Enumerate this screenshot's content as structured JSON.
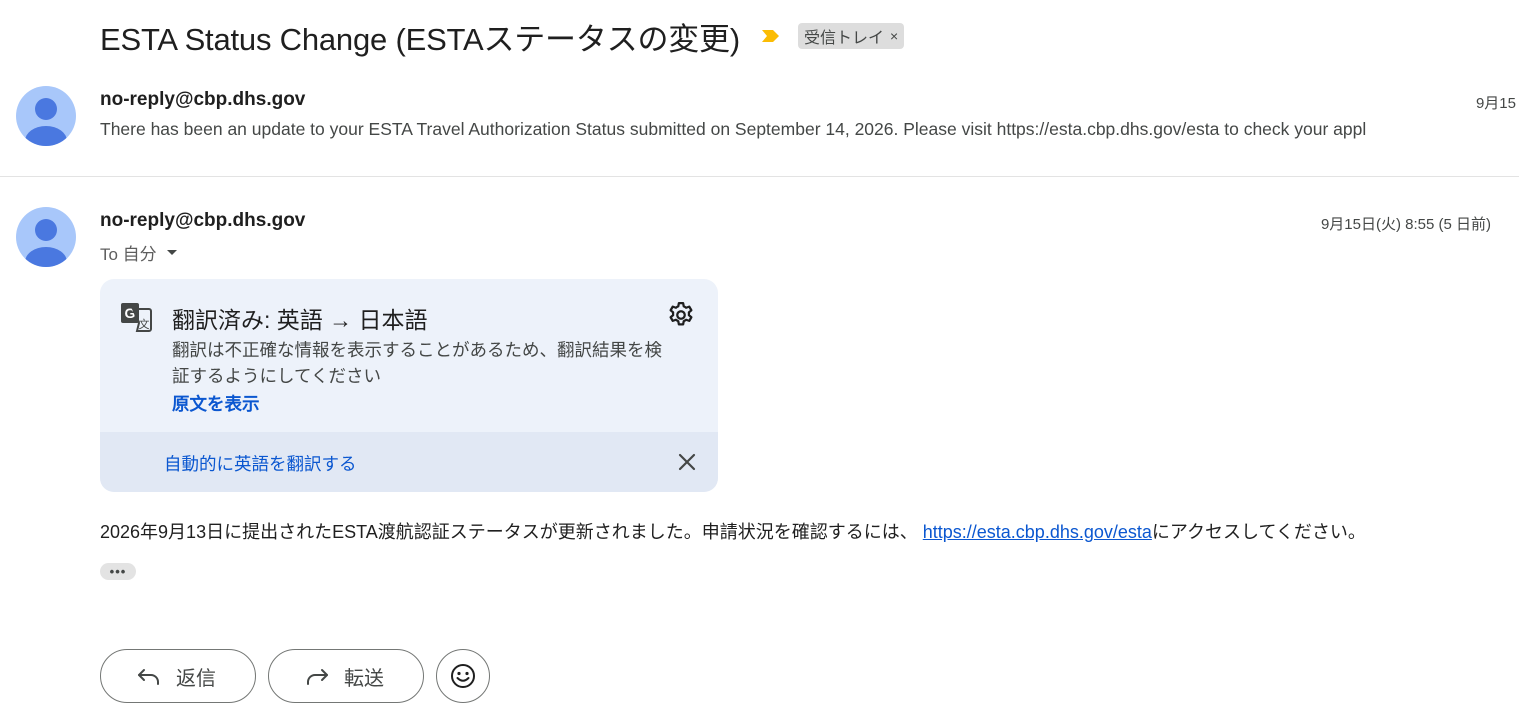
{
  "thread": {
    "subject": "ESTA Status Change (ESTAステータスの変更)",
    "label_chip": "受信トレイ",
    "label_remove": "×"
  },
  "collapsed_message": {
    "sender": "no-reply@cbp.dhs.gov",
    "date": "9月15",
    "snippet": "There has been an update to your ESTA Travel Authorization Status submitted on September 14, 2026. Please visit https://esta.cbp.dhs.gov/esta to check your appl"
  },
  "expanded_message": {
    "sender": "no-reply@cbp.dhs.gov",
    "date": "9月15日(火) 8:55 (5 日前)",
    "to": "To 自分",
    "body_before_link": "2026年9月13日に提出されたESTA渡航認証ステータスが更新されました。申請状況を確認するには、 ",
    "body_link": "https://esta.cbp.dhs.gov/esta",
    "body_after_link": "にアクセスしてください。",
    "more": "•••"
  },
  "translation": {
    "title": "翻訳済み: 英語 → 日本語",
    "description": "翻訳は不正確な情報を表示することがあるため、翻訳結果を検証するようにしてください",
    "show_original": "原文を表示",
    "auto_translate": "自動的に英語を翻訳する"
  },
  "actions": {
    "reply": "返信",
    "forward": "転送"
  },
  "icons": {
    "importance": "importance-marker-icon",
    "translate": "google-translate-icon",
    "settings": "gear-icon",
    "close": "close-icon",
    "reply": "reply-arrow-icon",
    "forward": "forward-arrow-icon",
    "emoji": "emoji-smile-icon",
    "avatar": "default-avatar-icon",
    "dropdown": "caret-down-icon"
  },
  "colors": {
    "link": "#0b57d0",
    "importance": "#fbbc04",
    "avatar_bg": "#a8c7fa",
    "avatar_fg": "#4a78e0",
    "translate_card_bg": "#edf2fa"
  }
}
